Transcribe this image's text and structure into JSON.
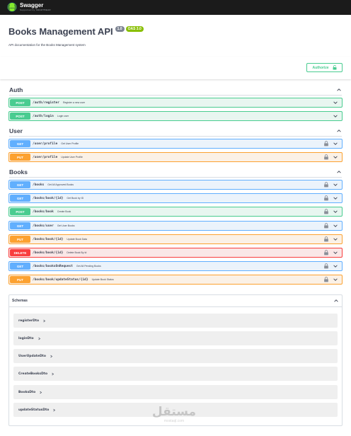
{
  "topbar": {
    "logo_mark": "{...}",
    "app_name": "Swagger",
    "app_sub": "Supported by SMARTBEAR"
  },
  "info": {
    "title": "Books Management API",
    "version": "1.0",
    "oas": "OAS 3.0",
    "description": "API documentation for the Books Management system"
  },
  "authorize": {
    "label": "Authorize"
  },
  "tags": [
    {
      "name": "Auth"
    },
    {
      "name": "User"
    },
    {
      "name": "Books"
    }
  ],
  "operations": [
    {
      "method": "POST",
      "path": "/auth/register",
      "summary": "Register a new user",
      "locked": false
    },
    {
      "method": "POST",
      "path": "/auth/login",
      "summary": "Login user",
      "locked": false
    },
    {
      "method": "GET",
      "path": "/user/profile",
      "summary": "Get User Profile",
      "locked": true
    },
    {
      "method": "PUT",
      "path": "/user/profile",
      "summary": "Update User Profile",
      "locked": true
    },
    {
      "method": "GET",
      "path": "/books",
      "summary": "Get All Approved Books",
      "locked": true
    },
    {
      "method": "GET",
      "path": "/books/book/{id}",
      "summary": "Get Book by ID",
      "locked": true
    },
    {
      "method": "POST",
      "path": "/books/book",
      "summary": "Create Book",
      "locked": true
    },
    {
      "method": "GET",
      "path": "/books/user",
      "summary": "Get User Books",
      "locked": true
    },
    {
      "method": "PUT",
      "path": "/books/book/{id}",
      "summary": "Update Book Data",
      "locked": true
    },
    {
      "method": "DELETE",
      "path": "/books/book/{id}",
      "summary": "Delete Book By Id",
      "locked": true
    },
    {
      "method": "GET",
      "path": "/books/booksOnRequest",
      "summary": "Get All Pending Books",
      "locked": true
    },
    {
      "method": "PUT",
      "path": "/books/book/updateStatus/{id}",
      "summary": "Update Book Status",
      "locked": true
    }
  ],
  "schemas": {
    "title": "Schemas",
    "items": [
      "registerDto",
      "loginDto",
      "UserUpdateDto",
      "CreateBooksDto",
      "BooksDto",
      "updateStatusDto"
    ]
  },
  "watermark": {
    "arabic": "مستقل",
    "latin": "mostaql.com"
  },
  "colors": {
    "post": "#49cc90",
    "get": "#61affe",
    "put": "#fca130",
    "delete": "#f93e3e",
    "topbar": "#1b1b1b",
    "accent": "#85ea2d"
  },
  "icons": {
    "chevron": "chevron-down-icon",
    "lock": "lock-icon",
    "unlock": "unlock-icon",
    "arrow": "chevron-right-icon"
  }
}
